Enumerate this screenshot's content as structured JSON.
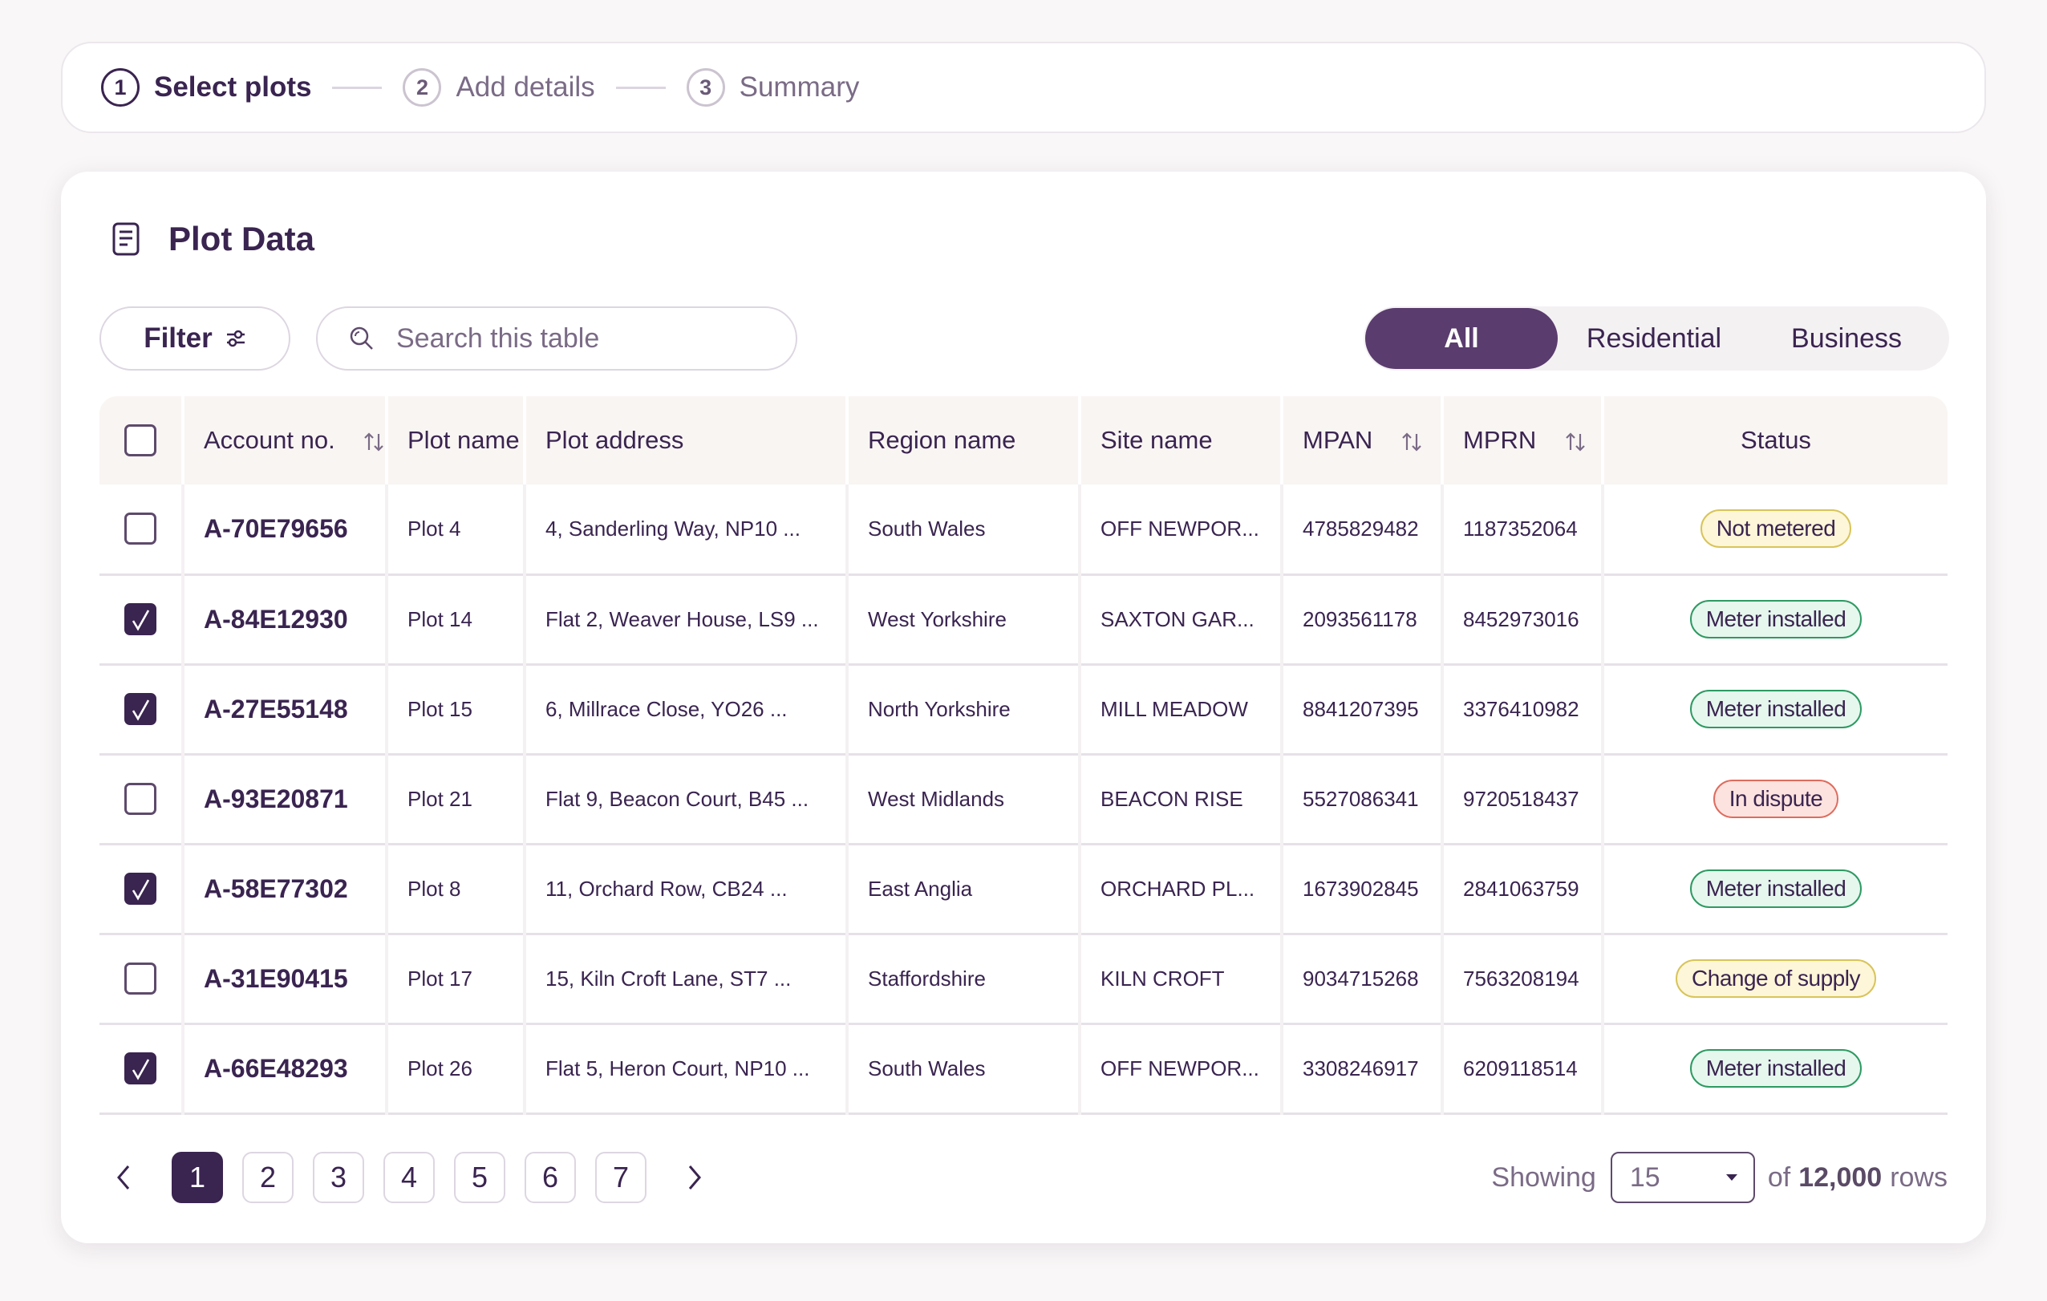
{
  "stepper": {
    "steps": [
      {
        "number": "1",
        "label": "Select plots",
        "active": true
      },
      {
        "number": "2",
        "label": "Add details",
        "active": false
      },
      {
        "number": "3",
        "label": "Summary",
        "active": false
      }
    ]
  },
  "card": {
    "title": "Plot Data",
    "icon": "document-icon"
  },
  "toolbar": {
    "filter_label": "Filter",
    "search_placeholder": "Search this table",
    "segments": [
      "All",
      "Residential",
      "Business"
    ],
    "selected_segment": "All"
  },
  "table": {
    "columns": {
      "account": "Account no.",
      "plot_name": "Plot name",
      "plot_address": "Plot address",
      "region": "Region name",
      "site": "Site name",
      "mpan": "MPAN",
      "mprn": "MPRN",
      "status": "Status"
    },
    "rows": [
      {
        "checked": false,
        "account": "A-70E79656",
        "plot_name": "Plot 4",
        "plot_address": "4,  Sanderling Way, NP10 ...",
        "region": "South Wales",
        "site": "OFF NEWPOR...",
        "mpan": "4785829482",
        "mprn": "1187352064",
        "status": "Not metered"
      },
      {
        "checked": true,
        "account": "A-84E12930",
        "plot_name": "Plot 14",
        "plot_address": "Flat 2,  Weaver House, LS9 ...",
        "region": "West Yorkshire",
        "site": "SAXTON GAR...",
        "mpan": "2093561178",
        "mprn": "8452973016",
        "status": "Meter installed"
      },
      {
        "checked": true,
        "account": "A-27E55148",
        "plot_name": "Plot 15",
        "plot_address": "6,  Millrace Close, YO26 ...",
        "region": "North Yorkshire",
        "site": "MILL MEADOW",
        "mpan": "8841207395",
        "mprn": "3376410982",
        "status": "Meter installed"
      },
      {
        "checked": false,
        "account": "A-93E20871",
        "plot_name": "Plot 21",
        "plot_address": "Flat 9,  Beacon Court, B45 ...",
        "region": "West Midlands",
        "site": "BEACON RISE",
        "mpan": "5527086341",
        "mprn": "9720518437",
        "status": "In dispute"
      },
      {
        "checked": true,
        "account": "A-58E77302",
        "plot_name": "Plot 8",
        "plot_address": "11,  Orchard Row, CB24 ...",
        "region": "East Anglia",
        "site": "ORCHARD PL...",
        "mpan": "1673902845",
        "mprn": "2841063759",
        "status": "Meter installed"
      },
      {
        "checked": false,
        "account": "A-31E90415",
        "plot_name": "Plot 17",
        "plot_address": "15,  Kiln Croft Lane, ST7 ...",
        "region": "Staffordshire",
        "site": "KILN CROFT",
        "mpan": "9034715268",
        "mprn": "7563208194",
        "status": "Change of supply"
      },
      {
        "checked": true,
        "account": "A-66E48293",
        "plot_name": "Plot 26",
        "plot_address": "Flat 5,  Heron Court, NP10 ...",
        "region": "South Wales",
        "site": "OFF NEWPOR...",
        "mpan": "3308246917",
        "mprn": "6209118514",
        "status": "Meter installed"
      }
    ]
  },
  "status_colors": {
    "Not metered": {
      "bg": "#fdf6d8",
      "border": "#d8c45a"
    },
    "Meter installed": {
      "bg": "#e6f7ee",
      "border": "#2e9a62"
    },
    "In dispute": {
      "bg": "#fde3df",
      "border": "#de6c5e"
    },
    "Change of supply": {
      "bg": "#fdf6d8",
      "border": "#d8c45a"
    }
  },
  "pagination": {
    "pages": [
      "1",
      "2",
      "3",
      "4",
      "5",
      "6",
      "7"
    ],
    "current_page": "1"
  },
  "rows_info": {
    "showing_label": "Showing",
    "page_size": "15",
    "of_label": "of",
    "total": "12,000",
    "rows_label": "rows"
  },
  "colors": {
    "brand": "#3a2450",
    "accent": "#5a3c6e"
  }
}
